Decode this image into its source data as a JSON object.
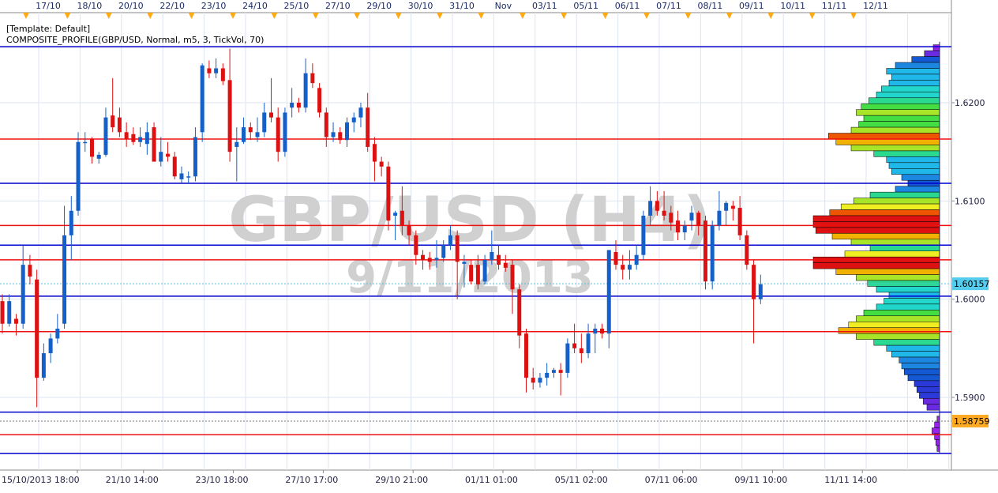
{
  "header": {
    "template_label": "[Template: Default]",
    "indicator_label": "COMPOSITE_PROFILE(GBP/USD, Normal, m5, 3, TickVol, 70)"
  },
  "watermark": {
    "symbol": "GBP/USD (H4)",
    "date": "9/11/2013"
  },
  "time_markers": [
    "17/10",
    "18/10",
    "20/10",
    "22/10",
    "23/10",
    "24/10",
    "25/10",
    "27/10",
    "29/10",
    "30/10",
    "31/10",
    "Nov",
    "03/11",
    "05/11",
    "06/11",
    "07/11",
    "08/11",
    "09/11",
    "10/11",
    "11/11",
    "12/11"
  ],
  "bottom_axis_labels": [
    "15/10/2013 18:00",
    "21/10 14:00",
    "23/10 18:00",
    "27/10 17:00",
    "29/10 21:00",
    "01/11 01:00",
    "05/11 02:00",
    "07/11 06:00",
    "09/11 10:00",
    "11/11 14:00"
  ],
  "price_axis": {
    "tick_labels": [
      "1.6200",
      "1.6100",
      "1.6000",
      "1.5900"
    ],
    "current_price": "1.60157",
    "marker_price": "1.58759",
    "current_price_color": "#55ccee",
    "marker_price_color": "#ffaa22"
  },
  "colors": {
    "bull": "#1560c8",
    "bear": "#dd1111",
    "high_volume_line": "#ee1111",
    "low_volume_line": "#0000cc",
    "grid": "#dde4f0",
    "watermark": "#cfcfcf",
    "time_marker": "#ffaa11"
  },
  "chart_data": {
    "type": "candlestick",
    "symbol": "GBP/USD",
    "timeframe": "H4",
    "ylim": [
      1.585,
      1.6305
    ],
    "yticks": [
      1.59,
      1.6,
      1.61,
      1.62
    ],
    "candles": [
      {
        "o": 1.5998,
        "h": 1.6005,
        "l": 1.5965,
        "c": 1.5975
      },
      {
        "o": 1.5975,
        "h": 1.6005,
        "l": 1.5972,
        "c": 1.5998
      },
      {
        "o": 1.598,
        "h": 1.5985,
        "l": 1.5963,
        "c": 1.5975
      },
      {
        "o": 1.5975,
        "h": 1.6055,
        "l": 1.597,
        "c": 1.6035
      },
      {
        "o": 1.6035,
        "h": 1.6045,
        "l": 1.6015,
        "c": 1.6023
      },
      {
        "o": 1.602,
        "h": 1.603,
        "l": 1.589,
        "c": 1.592
      },
      {
        "o": 1.592,
        "h": 1.5955,
        "l": 1.5917,
        "c": 1.5945
      },
      {
        "o": 1.5945,
        "h": 1.5965,
        "l": 1.5935,
        "c": 1.596
      },
      {
        "o": 1.596,
        "h": 1.5985,
        "l": 1.5955,
        "c": 1.597
      },
      {
        "o": 1.5975,
        "h": 1.6095,
        "l": 1.597,
        "c": 1.6065
      },
      {
        "o": 1.6065,
        "h": 1.6105,
        "l": 1.604,
        "c": 1.609
      },
      {
        "o": 1.609,
        "h": 1.617,
        "l": 1.6085,
        "c": 1.616
      },
      {
        "o": 1.616,
        "h": 1.617,
        "l": 1.615,
        "c": 1.616
      },
      {
        "o": 1.6163,
        "h": 1.6165,
        "l": 1.6138,
        "c": 1.6145
      },
      {
        "o": 1.6143,
        "h": 1.615,
        "l": 1.6138,
        "c": 1.6147
      },
      {
        "o": 1.6147,
        "h": 1.6195,
        "l": 1.6145,
        "c": 1.6185
      },
      {
        "o": 1.6187,
        "h": 1.6225,
        "l": 1.617,
        "c": 1.6175
      },
      {
        "o": 1.6185,
        "h": 1.6195,
        "l": 1.6165,
        "c": 1.617
      },
      {
        "o": 1.617,
        "h": 1.618,
        "l": 1.6155,
        "c": 1.6163
      },
      {
        "o": 1.6168,
        "h": 1.6175,
        "l": 1.6157,
        "c": 1.616
      },
      {
        "o": 1.616,
        "h": 1.6175,
        "l": 1.6155,
        "c": 1.6165
      },
      {
        "o": 1.6158,
        "h": 1.618,
        "l": 1.6147,
        "c": 1.617
      },
      {
        "o": 1.6175,
        "h": 1.618,
        "l": 1.615,
        "c": 1.614
      },
      {
        "o": 1.614,
        "h": 1.6165,
        "l": 1.6135,
        "c": 1.615
      },
      {
        "o": 1.6148,
        "h": 1.616,
        "l": 1.614,
        "c": 1.6145
      },
      {
        "o": 1.6145,
        "h": 1.615,
        "l": 1.6122,
        "c": 1.6125
      },
      {
        "o": 1.6122,
        "h": 1.6135,
        "l": 1.6118,
        "c": 1.6128
      },
      {
        "o": 1.6125,
        "h": 1.613,
        "l": 1.6118,
        "c": 1.6125
      },
      {
        "o": 1.6125,
        "h": 1.6175,
        "l": 1.612,
        "c": 1.6165
      },
      {
        "o": 1.617,
        "h": 1.624,
        "l": 1.616,
        "c": 1.6238
      },
      {
        "o": 1.6235,
        "h": 1.6243,
        "l": 1.6225,
        "c": 1.623
      },
      {
        "o": 1.623,
        "h": 1.6245,
        "l": 1.6225,
        "c": 1.6235
      },
      {
        "o": 1.6235,
        "h": 1.624,
        "l": 1.6218,
        "c": 1.6222
      },
      {
        "o": 1.6223,
        "h": 1.6255,
        "l": 1.614,
        "c": 1.615
      },
      {
        "o": 1.6155,
        "h": 1.6175,
        "l": 1.612,
        "c": 1.616
      },
      {
        "o": 1.616,
        "h": 1.6185,
        "l": 1.6158,
        "c": 1.6175
      },
      {
        "o": 1.6175,
        "h": 1.618,
        "l": 1.6162,
        "c": 1.617
      },
      {
        "o": 1.6165,
        "h": 1.6185,
        "l": 1.616,
        "c": 1.617
      },
      {
        "o": 1.617,
        "h": 1.62,
        "l": 1.6165,
        "c": 1.619
      },
      {
        "o": 1.619,
        "h": 1.6225,
        "l": 1.618,
        "c": 1.6185
      },
      {
        "o": 1.6185,
        "h": 1.6195,
        "l": 1.614,
        "c": 1.615
      },
      {
        "o": 1.615,
        "h": 1.6195,
        "l": 1.6145,
        "c": 1.619
      },
      {
        "o": 1.6195,
        "h": 1.6215,
        "l": 1.6185,
        "c": 1.62
      },
      {
        "o": 1.62,
        "h": 1.6205,
        "l": 1.619,
        "c": 1.6195
      },
      {
        "o": 1.6195,
        "h": 1.6245,
        "l": 1.619,
        "c": 1.623
      },
      {
        "o": 1.623,
        "h": 1.624,
        "l": 1.6215,
        "c": 1.622
      },
      {
        "o": 1.6215,
        "h": 1.622,
        "l": 1.6185,
        "c": 1.619
      },
      {
        "o": 1.619,
        "h": 1.6195,
        "l": 1.6155,
        "c": 1.6165
      },
      {
        "o": 1.6165,
        "h": 1.618,
        "l": 1.616,
        "c": 1.617
      },
      {
        "o": 1.617,
        "h": 1.6175,
        "l": 1.6158,
        "c": 1.6162
      },
      {
        "o": 1.6162,
        "h": 1.6185,
        "l": 1.6155,
        "c": 1.618
      },
      {
        "o": 1.618,
        "h": 1.619,
        "l": 1.617,
        "c": 1.6185
      },
      {
        "o": 1.6185,
        "h": 1.62,
        "l": 1.6175,
        "c": 1.6195
      },
      {
        "o": 1.6195,
        "h": 1.621,
        "l": 1.615,
        "c": 1.6155
      },
      {
        "o": 1.6158,
        "h": 1.6165,
        "l": 1.612,
        "c": 1.614
      },
      {
        "o": 1.614,
        "h": 1.6145,
        "l": 1.6125,
        "c": 1.6135
      },
      {
        "o": 1.6135,
        "h": 1.614,
        "l": 1.607,
        "c": 1.608
      },
      {
        "o": 1.6085,
        "h": 1.609,
        "l": 1.606,
        "c": 1.6088
      },
      {
        "o": 1.609,
        "h": 1.6115,
        "l": 1.6065,
        "c": 1.6075
      },
      {
        "o": 1.6075,
        "h": 1.608,
        "l": 1.6055,
        "c": 1.6065
      },
      {
        "o": 1.6065,
        "h": 1.607,
        "l": 1.6035,
        "c": 1.6045
      },
      {
        "o": 1.6045,
        "h": 1.605,
        "l": 1.603,
        "c": 1.604
      },
      {
        "o": 1.6042,
        "h": 1.6048,
        "l": 1.603,
        "c": 1.6038
      },
      {
        "o": 1.604,
        "h": 1.606,
        "l": 1.6032,
        "c": 1.6042
      },
      {
        "o": 1.6042,
        "h": 1.606,
        "l": 1.6038,
        "c": 1.6055
      },
      {
        "o": 1.6055,
        "h": 1.6075,
        "l": 1.605,
        "c": 1.6065
      },
      {
        "o": 1.6065,
        "h": 1.607,
        "l": 1.6,
        "c": 1.6038
      },
      {
        "o": 1.6036,
        "h": 1.6045,
        "l": 1.6012,
        "c": 1.6038
      },
      {
        "o": 1.6035,
        "h": 1.604,
        "l": 1.6015,
        "c": 1.6018
      },
      {
        "o": 1.6035,
        "h": 1.6045,
        "l": 1.601,
        "c": 1.6015
      },
      {
        "o": 1.6018,
        "h": 1.6045,
        "l": 1.6015,
        "c": 1.604
      },
      {
        "o": 1.604,
        "h": 1.607,
        "l": 1.6035,
        "c": 1.6048
      },
      {
        "o": 1.6045,
        "h": 1.6055,
        "l": 1.603,
        "c": 1.6035
      },
      {
        "o": 1.6037,
        "h": 1.6045,
        "l": 1.6028,
        "c": 1.6032
      },
      {
        "o": 1.6035,
        "h": 1.604,
        "l": 1.5985,
        "c": 1.601
      },
      {
        "o": 1.601,
        "h": 1.6015,
        "l": 1.595,
        "c": 1.5963
      },
      {
        "o": 1.5965,
        "h": 1.597,
        "l": 1.5905,
        "c": 1.592
      },
      {
        "o": 1.592,
        "h": 1.593,
        "l": 1.5908,
        "c": 1.5915
      },
      {
        "o": 1.5915,
        "h": 1.5925,
        "l": 1.591,
        "c": 1.592
      },
      {
        "o": 1.592,
        "h": 1.5935,
        "l": 1.5912,
        "c": 1.5925
      },
      {
        "o": 1.5925,
        "h": 1.593,
        "l": 1.592,
        "c": 1.5928
      },
      {
        "o": 1.5928,
        "h": 1.5935,
        "l": 1.5902,
        "c": 1.5925
      },
      {
        "o": 1.5925,
        "h": 1.596,
        "l": 1.592,
        "c": 1.5955
      },
      {
        "o": 1.5955,
        "h": 1.5975,
        "l": 1.5945,
        "c": 1.595
      },
      {
        "o": 1.595,
        "h": 1.5965,
        "l": 1.5935,
        "c": 1.5945
      },
      {
        "o": 1.5945,
        "h": 1.5975,
        "l": 1.594,
        "c": 1.5965
      },
      {
        "o": 1.5965,
        "h": 1.5975,
        "l": 1.5945,
        "c": 1.597
      },
      {
        "o": 1.597,
        "h": 1.5975,
        "l": 1.596,
        "c": 1.5965
      },
      {
        "o": 1.5965,
        "h": 1.605,
        "l": 1.595,
        "c": 1.605
      },
      {
        "o": 1.6048,
        "h": 1.606,
        "l": 1.603,
        "c": 1.6035
      },
      {
        "o": 1.6035,
        "h": 1.6045,
        "l": 1.602,
        "c": 1.603
      },
      {
        "o": 1.603,
        "h": 1.605,
        "l": 1.602,
        "c": 1.6035
      },
      {
        "o": 1.6035,
        "h": 1.6055,
        "l": 1.603,
        "c": 1.6045
      },
      {
        "o": 1.6045,
        "h": 1.609,
        "l": 1.604,
        "c": 1.6085
      },
      {
        "o": 1.6085,
        "h": 1.6115,
        "l": 1.6075,
        "c": 1.61
      },
      {
        "o": 1.61,
        "h": 1.611,
        "l": 1.6085,
        "c": 1.609
      },
      {
        "o": 1.609,
        "h": 1.611,
        "l": 1.608,
        "c": 1.6085
      },
      {
        "o": 1.6088,
        "h": 1.6095,
        "l": 1.607,
        "c": 1.6078
      },
      {
        "o": 1.608,
        "h": 1.609,
        "l": 1.606,
        "c": 1.6068
      },
      {
        "o": 1.6068,
        "h": 1.608,
        "l": 1.606,
        "c": 1.6075
      },
      {
        "o": 1.608,
        "h": 1.6095,
        "l": 1.607,
        "c": 1.6088
      },
      {
        "o": 1.6088,
        "h": 1.609,
        "l": 1.6065,
        "c": 1.6075
      },
      {
        "o": 1.608,
        "h": 1.6085,
        "l": 1.601,
        "c": 1.6018
      },
      {
        "o": 1.6018,
        "h": 1.608,
        "l": 1.601,
        "c": 1.6075
      },
      {
        "o": 1.6075,
        "h": 1.611,
        "l": 1.607,
        "c": 1.609
      },
      {
        "o": 1.609,
        "h": 1.61,
        "l": 1.6075,
        "c": 1.6098
      },
      {
        "o": 1.6095,
        "h": 1.61,
        "l": 1.608,
        "c": 1.6092
      },
      {
        "o": 1.6093,
        "h": 1.6105,
        "l": 1.606,
        "c": 1.6065
      },
      {
        "o": 1.6065,
        "h": 1.607,
        "l": 1.603,
        "c": 1.6035
      },
      {
        "o": 1.6035,
        "h": 1.604,
        "l": 1.5955,
        "c": 1.6
      },
      {
        "o": 1.6,
        "h": 1.6025,
        "l": 1.5995,
        "c": 1.6015
      }
    ],
    "high_volume_levels": [
      1.6163,
      1.6075,
      1.604,
      1.5967,
      1.5862
    ],
    "low_volume_levels": [
      1.6257,
      1.6118,
      1.6055,
      1.6003,
      1.5885,
      1.5843
    ],
    "profile": {
      "bins": [
        {
          "price": 1.6256,
          "v": 0.05
        },
        {
          "price": 1.625,
          "v": 0.12
        },
        {
          "price": 1.6244,
          "v": 0.22
        },
        {
          "price": 1.6238,
          "v": 0.35
        },
        {
          "price": 1.6232,
          "v": 0.42
        },
        {
          "price": 1.6226,
          "v": 0.38
        },
        {
          "price": 1.622,
          "v": 0.4
        },
        {
          "price": 1.6214,
          "v": 0.46
        },
        {
          "price": 1.6208,
          "v": 0.5
        },
        {
          "price": 1.6202,
          "v": 0.56
        },
        {
          "price": 1.6196,
          "v": 0.62
        },
        {
          "price": 1.619,
          "v": 0.66
        },
        {
          "price": 1.6184,
          "v": 0.6
        },
        {
          "price": 1.6178,
          "v": 0.64
        },
        {
          "price": 1.6172,
          "v": 0.7
        },
        {
          "price": 1.6166,
          "v": 0.88
        },
        {
          "price": 1.616,
          "v": 0.82
        },
        {
          "price": 1.6154,
          "v": 0.7
        },
        {
          "price": 1.6148,
          "v": 0.52
        },
        {
          "price": 1.6142,
          "v": 0.42
        },
        {
          "price": 1.6136,
          "v": 0.4
        },
        {
          "price": 1.613,
          "v": 0.38
        },
        {
          "price": 1.6124,
          "v": 0.3
        },
        {
          "price": 1.6118,
          "v": 0.25
        },
        {
          "price": 1.6112,
          "v": 0.35
        },
        {
          "price": 1.6106,
          "v": 0.55
        },
        {
          "price": 1.61,
          "v": 0.68
        },
        {
          "price": 1.6094,
          "v": 0.78
        },
        {
          "price": 1.6088,
          "v": 0.87
        },
        {
          "price": 1.6082,
          "v": 1.0
        },
        {
          "price": 1.6076,
          "v": 1.0
        },
        {
          "price": 1.607,
          "v": 0.98
        },
        {
          "price": 1.6064,
          "v": 0.85
        },
        {
          "price": 1.6058,
          "v": 0.7
        },
        {
          "price": 1.6052,
          "v": 0.55
        },
        {
          "price": 1.6046,
          "v": 0.75
        },
        {
          "price": 1.604,
          "v": 1.0
        },
        {
          "price": 1.6034,
          "v": 1.0
        },
        {
          "price": 1.6028,
          "v": 0.82
        },
        {
          "price": 1.6022,
          "v": 0.66
        },
        {
          "price": 1.6016,
          "v": 0.57
        },
        {
          "price": 1.601,
          "v": 0.5
        },
        {
          "price": 1.6004,
          "v": 0.4
        },
        {
          "price": 1.5998,
          "v": 0.44
        },
        {
          "price": 1.5992,
          "v": 0.5
        },
        {
          "price": 1.5986,
          "v": 0.6
        },
        {
          "price": 1.598,
          "v": 0.66
        },
        {
          "price": 1.5974,
          "v": 0.72
        },
        {
          "price": 1.5968,
          "v": 0.8
        },
        {
          "price": 1.5962,
          "v": 0.66
        },
        {
          "price": 1.5956,
          "v": 0.52
        },
        {
          "price": 1.595,
          "v": 0.42
        },
        {
          "price": 1.5944,
          "v": 0.38
        },
        {
          "price": 1.5938,
          "v": 0.32
        },
        {
          "price": 1.5932,
          "v": 0.3
        },
        {
          "price": 1.5926,
          "v": 0.28
        },
        {
          "price": 1.592,
          "v": 0.25
        },
        {
          "price": 1.5914,
          "v": 0.2
        },
        {
          "price": 1.5908,
          "v": 0.18
        },
        {
          "price": 1.5902,
          "v": 0.16
        },
        {
          "price": 1.5896,
          "v": 0.13
        },
        {
          "price": 1.589,
          "v": 0.1
        },
        {
          "price": 1.5878,
          "v": 0.02
        },
        {
          "price": 1.5872,
          "v": 0.04
        },
        {
          "price": 1.5866,
          "v": 0.06
        },
        {
          "price": 1.586,
          "v": 0.04
        },
        {
          "price": 1.5854,
          "v": 0.03
        },
        {
          "price": 1.5848,
          "v": 0.02
        }
      ]
    }
  }
}
